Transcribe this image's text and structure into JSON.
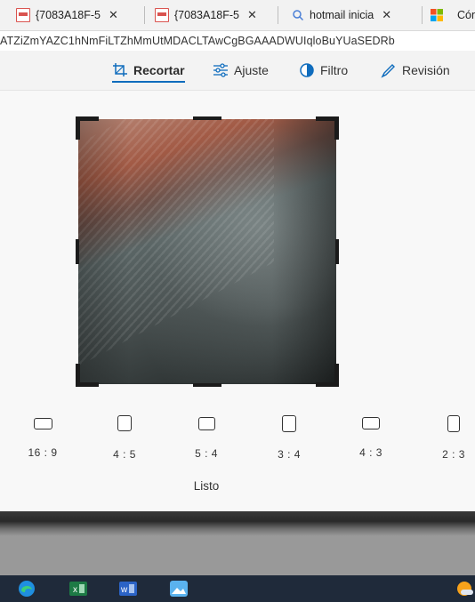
{
  "browser": {
    "tabs": [
      {
        "label": "{7083A18F-5",
        "fade": "",
        "icon": "pdf-icon"
      },
      {
        "label": "{7083A18F-5",
        "fade": "",
        "icon": "pdf-icon"
      },
      {
        "label": "hotmail inicia",
        "fade": "",
        "icon": "search-icon"
      },
      {
        "label": "Cón",
        "icon": "microsoft-icon"
      }
    ],
    "tab_close": "✕",
    "url_fragment": "ATZiZmYAZC1hNmFiLTZhMmUtMDACLTAwCgBGAAADWUIqloBuYUaSEDRb"
  },
  "editor": {
    "tools": [
      {
        "label": "Recortar",
        "icon": "crop-icon",
        "active": true
      },
      {
        "label": "Ajuste",
        "icon": "adjust-sliders-icon",
        "active": false
      },
      {
        "label": "Filtro",
        "icon": "filter-icon",
        "active": false
      },
      {
        "label": "Revisión",
        "icon": "pen-icon",
        "active": false
      }
    ],
    "aspect_ratios": [
      "16 : 9",
      "4 : 5",
      "5 : 4",
      "3 : 4",
      "4 : 3",
      "2 : 3"
    ],
    "done_label": "Listo",
    "accent": "#0f6cbd"
  },
  "taskbar": {
    "apps": [
      "edge-icon",
      "excel-icon",
      "word-icon",
      "photos-icon",
      "weather-icon"
    ]
  }
}
